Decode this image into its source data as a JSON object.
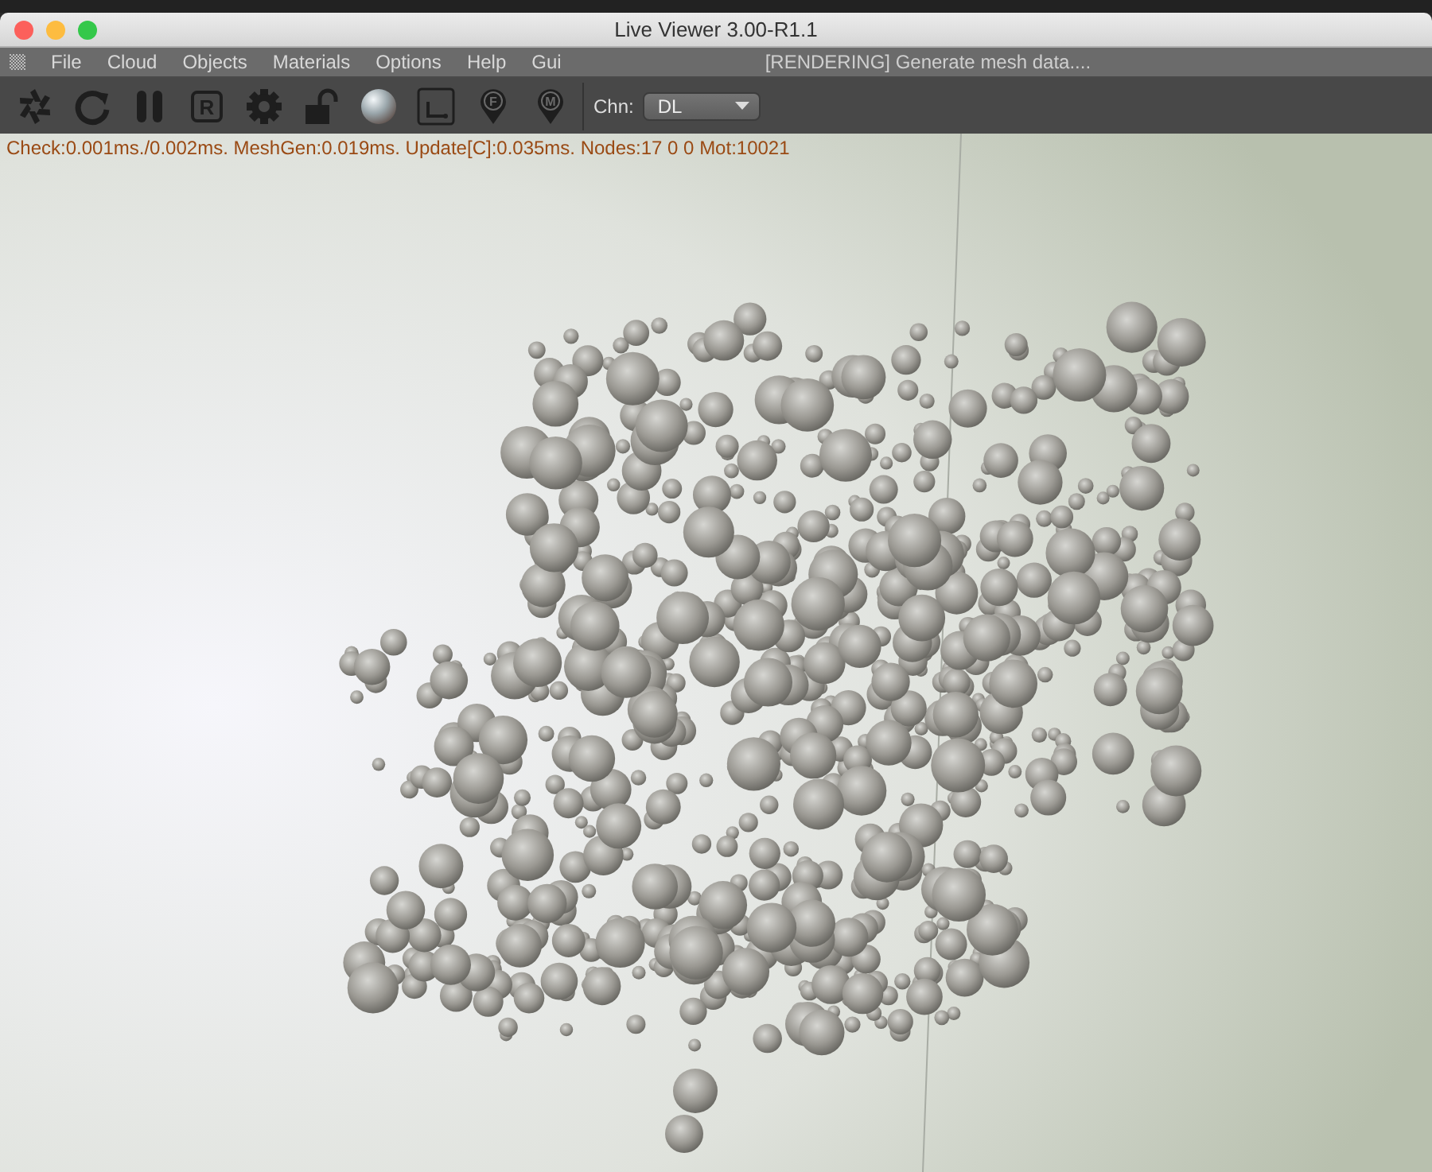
{
  "window": {
    "title": "Live Viewer 3.00-R1.1"
  },
  "menu": [
    {
      "label": "File"
    },
    {
      "label": "Cloud"
    },
    {
      "label": "Objects"
    },
    {
      "label": "Materials"
    },
    {
      "label": "Options"
    },
    {
      "label": "Help"
    },
    {
      "label": "Gui"
    }
  ],
  "menu_status": "[RENDERING] Generate mesh data....",
  "toolbar": [
    {
      "kind": "aperture"
    },
    {
      "kind": "refresh"
    },
    {
      "kind": "pause"
    },
    {
      "kind": "letterbox",
      "label": "R"
    },
    {
      "kind": "gear"
    },
    {
      "kind": "lock"
    },
    {
      "kind": "sphere"
    },
    {
      "kind": "region"
    },
    {
      "kind": "pin",
      "label": "F"
    },
    {
      "kind": "pin",
      "label": "M"
    }
  ],
  "channel": {
    "label": "Chn:",
    "value": "DL"
  },
  "stats": "Check:0.001ms./0.002ms. MeshGen:0.019ms. Update[C]:0.035ms. Nodes:17  0 0 Mot:10021"
}
